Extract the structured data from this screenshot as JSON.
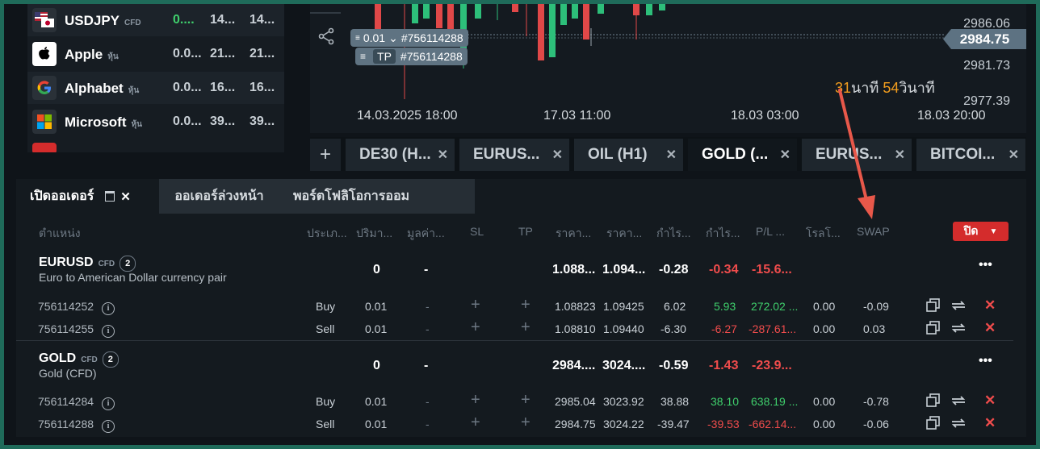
{
  "watchlist": [
    {
      "name": "USDJPY",
      "tag": "CFD",
      "change": "0....",
      "bid": "14...",
      "ask": "14...",
      "icon": "flag-us-jp-icon"
    },
    {
      "name": "Apple",
      "tag": "หุ้น",
      "change": "0.0...",
      "bid": "21...",
      "ask": "21...",
      "icon": "apple-logo-icon"
    },
    {
      "name": "Alphabet",
      "tag": "หุ้น",
      "change": "0.0...",
      "bid": "16...",
      "ask": "16...",
      "icon": "google-logo-icon"
    },
    {
      "name": "Microsoft",
      "tag": "หุ้น",
      "change": "0.0...",
      "bid": "39...",
      "ask": "39...",
      "icon": "microsoft-logo-icon"
    }
  ],
  "chart": {
    "price_levels": [
      "2986.06",
      "2981.73",
      "2977.39"
    ],
    "current_price": "2984.75",
    "order_tag_volume": "0.01",
    "order_tag_id": "#756114288",
    "tp_tag_label": "TP",
    "tp_tag_id": "#756114288",
    "x_labels": [
      "14.03.2025 18:00",
      "17.03 11:00",
      "18.03 03:00",
      "18.03 20:00"
    ],
    "timer_min": "31",
    "timer_min_unit": "นาที",
    "timer_sec": "54",
    "timer_sec_unit": "วินาที"
  },
  "chart_tabs": [
    "DE30 (H...",
    "EURUS...",
    "OIL (H1)",
    "GOLD (...",
    "EURUS...",
    "BITCOI..."
  ],
  "active_chart_tab": 3,
  "panel": {
    "tabs": [
      "เปิดออเดอร์",
      "ออเดอร์ล่วงหน้า",
      "พอร์ตโฟลิโอการออม"
    ],
    "close_label": "ปิด",
    "headers": [
      "ตำแหน่ง",
      "ประเภ...",
      "ปริมา...",
      "มูลค่า...",
      "SL",
      "TP",
      "ราคา...",
      "ราคา...",
      "กำไร...",
      "กำไร...",
      "P/L ...",
      "โรลโ...",
      "SWAP"
    ],
    "groups": [
      {
        "name": "EURUSD",
        "tag": "CFD",
        "count": "2",
        "desc": "Euro to American Dollar currency pair",
        "volume": "0",
        "value": "-",
        "open": "1.088...",
        "current": "1.094...",
        "profit": "-0.28",
        "profit2": "-0.34",
        "pl": "-15.6...",
        "rows": [
          {
            "id": "756114252",
            "type": "Buy",
            "volume": "0.01",
            "value": "-",
            "open": "1.08823",
            "current": "1.09425",
            "profit": "6.02",
            "profit2": "5.93",
            "pl": "272.02 ...",
            "rollover": "0.00",
            "swap": "-0.09"
          },
          {
            "id": "756114255",
            "type": "Sell",
            "volume": "0.01",
            "value": "-",
            "open": "1.08810",
            "current": "1.09440",
            "profit": "-6.30",
            "profit2": "-6.27",
            "pl": "-287.61...",
            "rollover": "0.00",
            "swap": "0.03"
          }
        ]
      },
      {
        "name": "GOLD",
        "tag": "CFD",
        "count": "2",
        "desc": "Gold (CFD)",
        "volume": "0",
        "value": "-",
        "open": "2984....",
        "current": "3024....",
        "profit": "-0.59",
        "profit2": "-1.43",
        "pl": "-23.9...",
        "rows": [
          {
            "id": "756114284",
            "type": "Buy",
            "volume": "0.01",
            "value": "-",
            "open": "2985.04",
            "current": "3023.92",
            "profit": "38.88",
            "profit2": "38.10",
            "pl": "638.19 ...",
            "rollover": "0.00",
            "swap": "-0.78"
          },
          {
            "id": "756114288",
            "type": "Sell",
            "volume": "0.01",
            "value": "-",
            "open": "2984.75",
            "current": "3024.22",
            "profit": "-39.47",
            "profit2": "-39.53",
            "pl": "-662.14...",
            "rollover": "0.00",
            "swap": "-0.06"
          }
        ]
      }
    ]
  },
  "colors": {
    "accent_red": "#d42c2c",
    "profit_green": "#3fcf6c",
    "loss_red": "#f04c4c",
    "timer_orange": "#f29d1e",
    "frame_green": "#1f6b5a"
  }
}
